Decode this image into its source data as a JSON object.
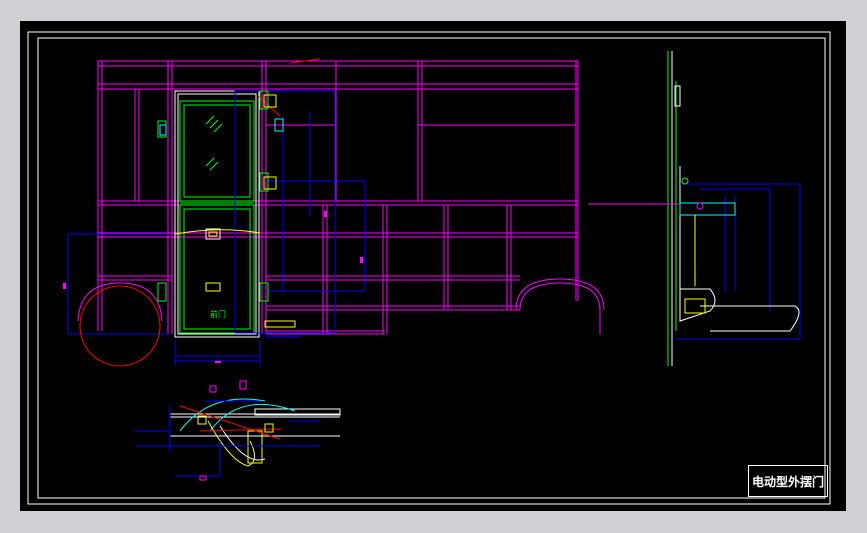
{
  "title_block": {
    "text": "电动型外摆门"
  },
  "labels": {
    "front_door_label": "前门"
  },
  "colors": {
    "background": "#000000",
    "frame": "#ff00ff",
    "door": "#00ff00",
    "door_frame": "#ffffff",
    "dimension": "#0000ff",
    "wheel": "#ff0000",
    "mechanism": "#ffff00",
    "cyan": "#00ffff",
    "chrome": "#cfd0d4"
  }
}
